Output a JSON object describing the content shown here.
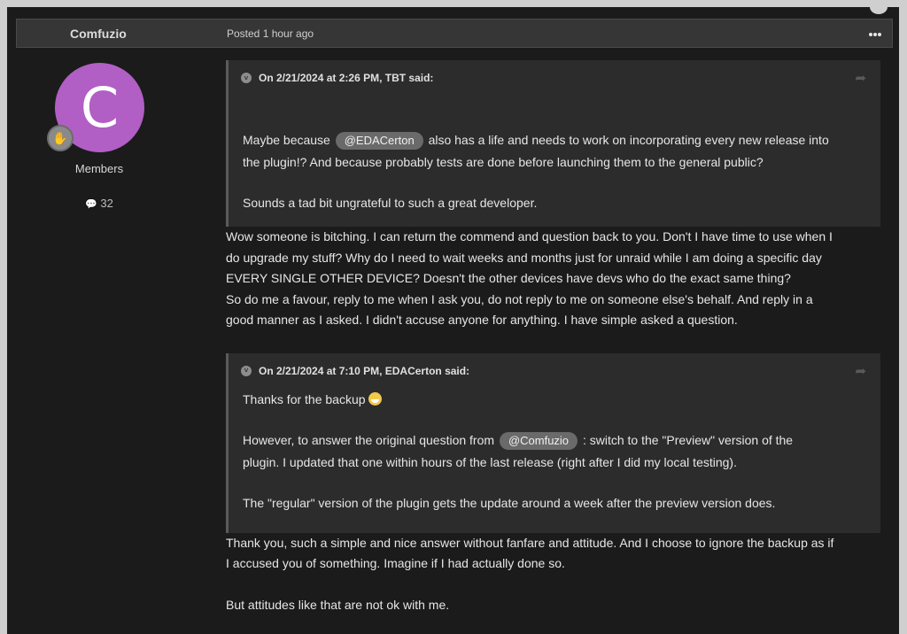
{
  "post": {
    "author": "Comfuzio",
    "posted": "Posted 1 hour ago"
  },
  "author_panel": {
    "avatar_letter": "C",
    "avatar_color": "#b15fc4",
    "group": "Members",
    "post_count": "32"
  },
  "quote1": {
    "header": "On 2/21/2024 at 2:26 PM, TBT said:",
    "line1_pre": "Maybe because",
    "mention": "@EDACerton",
    "line1_post": "also has a life and needs to work on incorporating every new release into",
    "line2": "the plugin!? And because probably tests are done before launching them to the general public?",
    "line3": "Sounds a tad bit ungrateful to such a great developer."
  },
  "reply1": {
    "l1": "Wow someone is bitching. I can return the commend and question back to you. Don't I have time to use when I",
    "l2": "do upgrade my stuff? Why do I need to wait weeks and months just for unraid while I am doing a specific day",
    "l3": "EVERY SINGLE OTHER DEVICE? Doesn't the other devices have devs who do the exact same thing?",
    "l4": "So do me a favour, reply to me when I ask you, do not reply to me on someone else's behalf. And reply in a",
    "l5": "good manner as I asked. I didn't accuse anyone for anything. I have simple asked a question."
  },
  "quote2": {
    "header": "On 2/21/2024 at 7:10 PM, EDACerton said:",
    "thanks": "Thanks for the backup",
    "line2_pre": "However, to answer the original question from",
    "mention": "@Comfuzio",
    "line2_post": ": switch to the \"Preview\" version of the",
    "line3": "plugin. I updated that one within hours of the last release (right after I did my local testing).",
    "line4": "The \"regular\" version of the plugin gets the update around a week after the preview version does."
  },
  "reply2": {
    "l1": "Thank you, such a simple and nice answer without fanfare and attitude. And I choose to ignore the backup as if",
    "l2": "I accused you of something. Imagine if I had actually done so.",
    "l3": "But attitudes like that are not ok with me."
  }
}
